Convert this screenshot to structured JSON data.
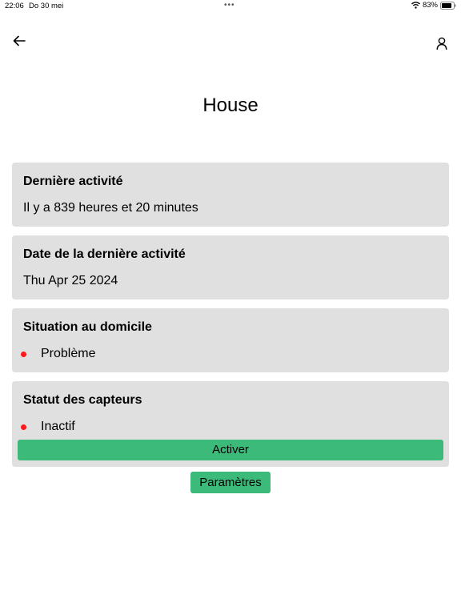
{
  "status_bar": {
    "time": "22:06",
    "date": "Do 30 mei",
    "battery": "83%"
  },
  "header": {
    "title": "House",
    "icons": {
      "back": "arrow-left-icon",
      "profile": "user-icon"
    }
  },
  "cards": {
    "last_activity": {
      "title": "Dernière activité",
      "value": "Il y a 839 heures et 20 minutes"
    },
    "last_activity_date": {
      "title": "Date de la dernière activité",
      "value": "Thu Apr 25 2024"
    },
    "home_situation": {
      "title": "Situation au domicile",
      "status": "Problème"
    },
    "sensor_status": {
      "title": "Statut des capteurs",
      "status": "Inactif",
      "activate_label": "Activer"
    }
  },
  "settings_label": "Paramètres",
  "colors": {
    "card_bg": "#e0e0e0",
    "accent_green": "#3cba7a",
    "status_red": "#ff1a1a"
  }
}
